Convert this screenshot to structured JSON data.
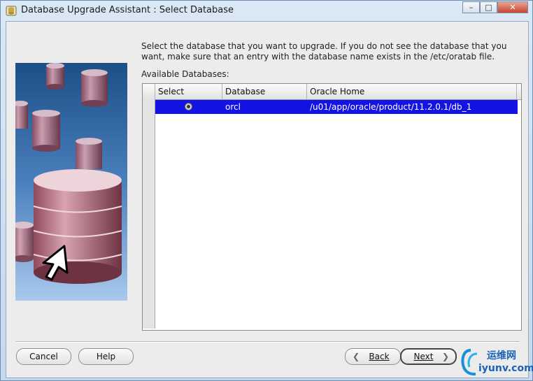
{
  "window": {
    "title": "Database Upgrade Assistant : Select Database",
    "controls": [
      "minimize-icon",
      "maximize-icon",
      "close-icon"
    ]
  },
  "main": {
    "instruction": "Select the database that you want to upgrade. If you do not see the database that you want, make sure that an entry with the database name exists in the /etc/oratab file.",
    "available_label": "Available Databases:",
    "table": {
      "columns": [
        "Select",
        "Database",
        "Oracle Home"
      ],
      "rows": [
        {
          "selected": true,
          "database": "orcl",
          "oracle_home": "/u01/app/oracle/product/11.2.0.1/db_1"
        }
      ]
    }
  },
  "footer": {
    "cancel": "Cancel",
    "help": "Help",
    "back": "Back",
    "next": "Next"
  },
  "watermark": {
    "line1": "运维网",
    "line2": "iyunv.com"
  },
  "colors": {
    "selection": "#1313e6",
    "window_bg": "#ececec"
  }
}
